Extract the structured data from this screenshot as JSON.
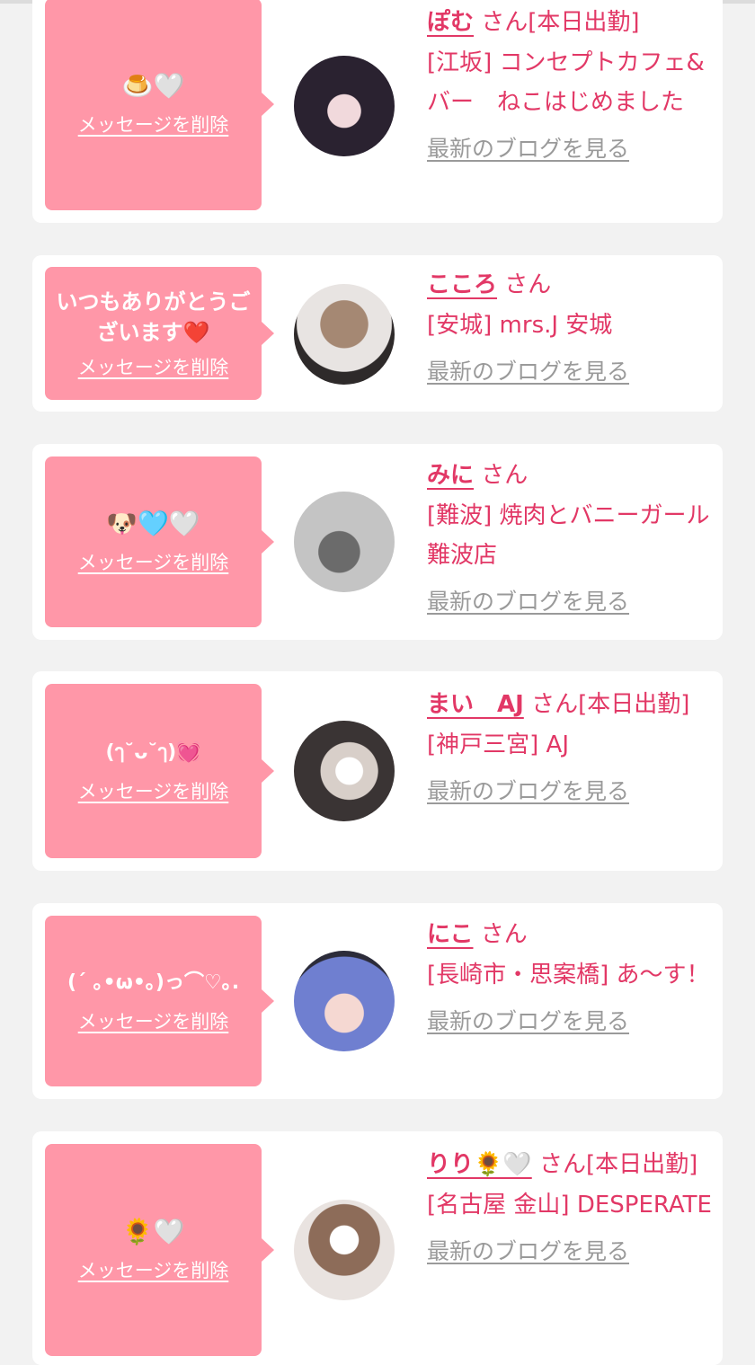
{
  "items": [
    {
      "message": "🍮🤍",
      "delete_label": "メッセージを削除",
      "name": "ぽむ",
      "suffix": "さん[本日出勤]",
      "shop": "[江坂] コンセプトカフェ&バー　ねこはじめました",
      "blog_label": "最新のブログを見る",
      "avatar_colors": [
        "#2a2230",
        "#f1d9dc"
      ]
    },
    {
      "message": "いつもありがとうございます❤️",
      "delete_label": "メッセージを削除",
      "name": "こころ",
      "suffix": "さん",
      "shop": "[安城] mrs.J 安城",
      "blog_label": "最新のブログを見る",
      "avatar_colors": [
        "#8b6e5c",
        "#2e2a2a"
      ]
    },
    {
      "message": "🐶🩵🤍",
      "delete_label": "メッセージを削除",
      "name": "みに",
      "suffix": "さん",
      "shop": "[難波] 焼肉とバニーガール難波店",
      "blog_label": "最新のブログを見る",
      "avatar_colors": [
        "#bfbfbf",
        "#5d5d5d"
      ]
    },
    {
      "message": "(ๅ˘ᴗ˘ๅ)💓",
      "delete_label": "メッセージを削除",
      "name": "まい　AJ",
      "suffix": "さん[本日出勤]",
      "shop": "[神戸三宮] AJ",
      "blog_label": "最新のブログを見る",
      "avatar_colors": [
        "#3a3434",
        "#d8cfc9"
      ]
    },
    {
      "message": "(´ ｡•ω•｡)っ⌒♡｡.",
      "delete_label": "メッセージを削除",
      "name": "にこ",
      "suffix": "さん",
      "shop": "[長崎市・思案橋] あ〜す！",
      "blog_label": "最新のブログを見る",
      "avatar_colors": [
        "#6f7fd0",
        "#f5d8d2"
      ]
    },
    {
      "message": "🌻🤍",
      "delete_label": "メッセージを削除",
      "name": "りり🌻🤍",
      "suffix": "さん[本日出勤]",
      "shop": "[名古屋 金山] DESPERATE",
      "blog_label": "最新のブログを見る",
      "avatar_colors": [
        "#8d6c59",
        "#e9e3e0"
      ]
    }
  ]
}
